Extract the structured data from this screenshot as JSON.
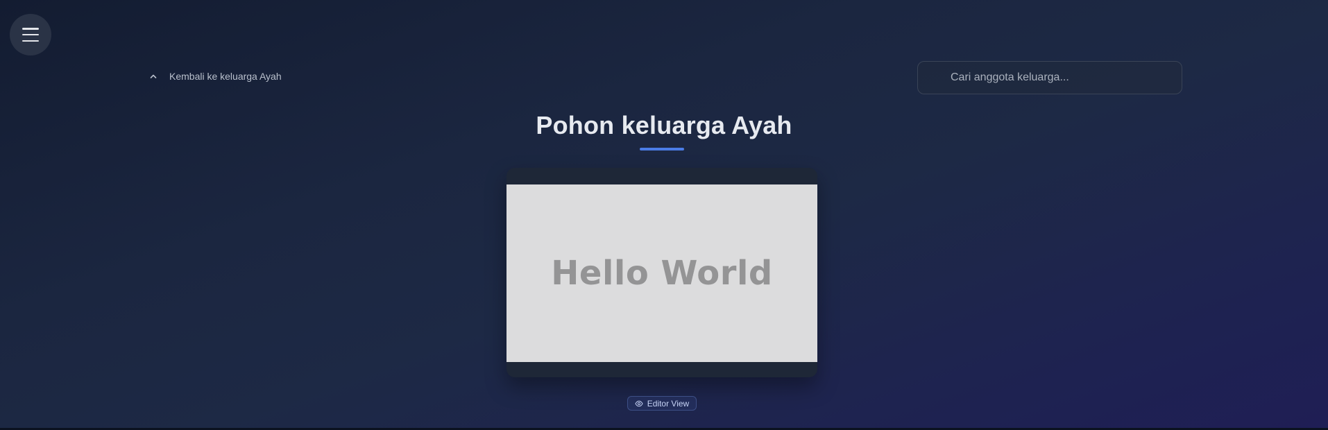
{
  "nav": {
    "menu_icon": "hamburger-menu-icon",
    "back_icon": "chevron-up-icon",
    "back_label": "Kembali ke keluarga Ayah"
  },
  "search": {
    "placeholder": "Cari anggota keluarga...",
    "value": ""
  },
  "page": {
    "title": "Pohon keluarga Ayah",
    "accent_color": "#4b7ce6"
  },
  "preview": {
    "text": "Hello World"
  },
  "editor": {
    "icon": "eye-icon",
    "label": "Editor View"
  }
}
